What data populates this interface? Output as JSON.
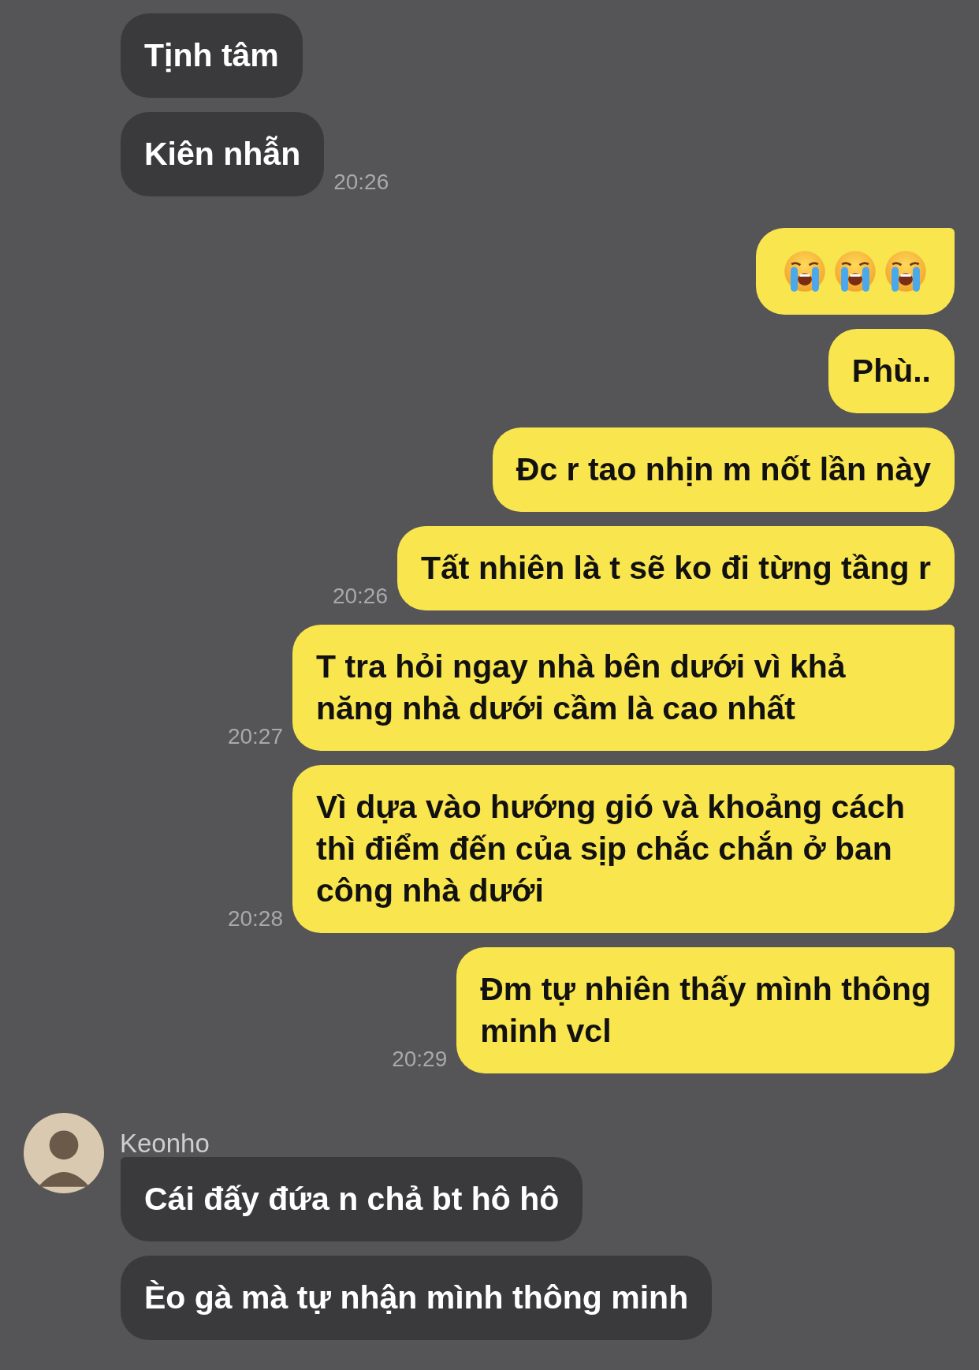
{
  "messages": [
    {
      "mine": false,
      "kind": "text",
      "text": "Tịnh tâm",
      "tail": false
    },
    {
      "mine": false,
      "kind": "text",
      "text": "Kiên nhẫn",
      "time": "20:26",
      "tail": false
    },
    {
      "mine": true,
      "kind": "emoji",
      "emojis": [
        {
          "kind": "crying"
        },
        {
          "kind": "crying"
        },
        {
          "kind": "crying"
        }
      ],
      "tail": true
    },
    {
      "mine": true,
      "kind": "text",
      "text": "Phù..",
      "tail": false
    },
    {
      "mine": true,
      "kind": "text",
      "text": "Đc r tao nhịn m nốt lần này",
      "tail": false
    },
    {
      "mine": true,
      "kind": "text",
      "text": "Tất nhiên là t sẽ ko đi từng tầng r",
      "time": "20:26",
      "tail": false
    },
    {
      "mine": true,
      "kind": "text",
      "text": "T tra hỏi ngay nhà bên dưới vì khả năng nhà dưới cầm là cao nhất",
      "time": "20:27",
      "tail": true
    },
    {
      "mine": true,
      "kind": "text",
      "text": "Vì dựa vào hướng gió và khoảng cách thì điểm đến của sịp chắc chắn ở ban công nhà dưới",
      "time": "20:28",
      "tail": true
    },
    {
      "mine": true,
      "kind": "text",
      "text": "Đm tự nhiên thấy mình thông\nminh vcl",
      "time": "20:29",
      "tail": true
    },
    {
      "mine": false,
      "kind": "text",
      "sender": "Keonho",
      "text": "Cái đấy đứa n chả bt hô hô",
      "tail": true
    },
    {
      "mine": false,
      "kind": "text",
      "text": "Èo gà mà tự nhận mình thông minh",
      "tail": false
    }
  ]
}
